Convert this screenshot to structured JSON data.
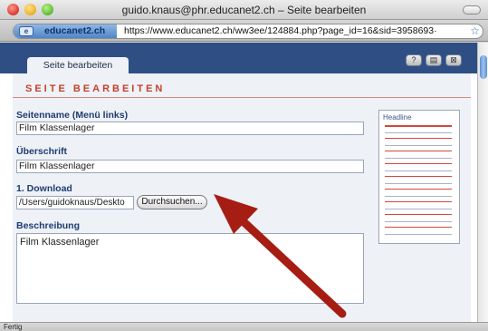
{
  "window": {
    "title": "guido.knaus@phr.educanet2.ch – Seite bearbeiten"
  },
  "address_bar": {
    "site_name": "educanet2.ch",
    "url": "https://www.educanet2.ch/ww3ee/124884.php?page_id=16&sid=3958693·"
  },
  "page": {
    "active_tab": "Seite bearbeiten",
    "toolbar_icons": [
      "help-icon",
      "print-icon",
      "close-icon"
    ],
    "toolbar_icon_glyphs": [
      "?",
      "▤",
      "⊠"
    ],
    "section_title": "SEITE BEARBEITEN",
    "fields": {
      "page_name": {
        "label": "Seitenname (Menü links)",
        "value": "Film Klassenlager"
      },
      "heading": {
        "label": "Überschrift",
        "value": "Film Klassenlager"
      },
      "download": {
        "label": "1. Download",
        "value": "/Users/guidoknaus/Deskto",
        "button": "Durchsuchen..."
      },
      "description": {
        "label": "Beschreibung",
        "value": "Film Klassenlager"
      }
    },
    "preview": {
      "title": "Headline"
    }
  },
  "statusbar": {
    "text": "Fertig"
  },
  "colors": {
    "accent_red": "#c6402a",
    "nav_blue": "#2f4f84",
    "arrow": "#a61d14"
  }
}
